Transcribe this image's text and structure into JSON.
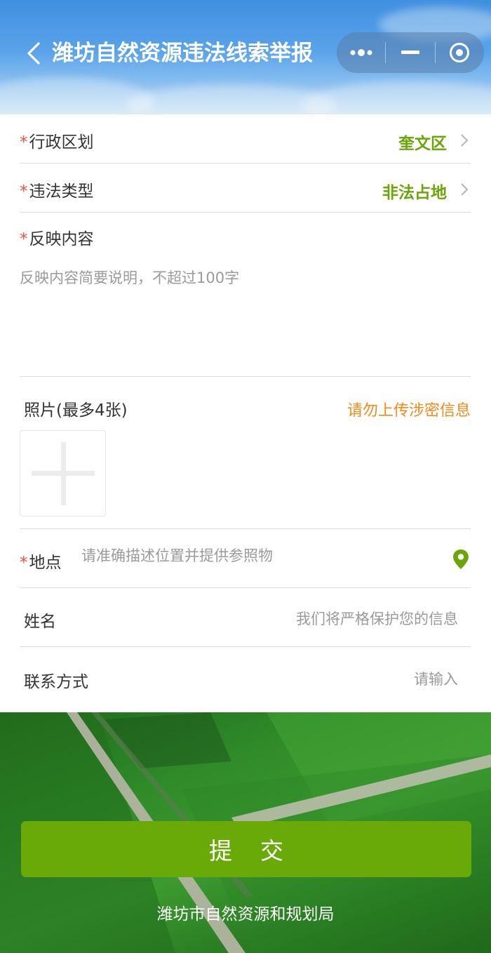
{
  "header": {
    "title": "潍坊自然资源违法线索举报",
    "icons": [
      "back-icon",
      "more-icon",
      "minimize-icon",
      "close-icon"
    ]
  },
  "form": {
    "required_mark": "*",
    "district": {
      "label": "行政区划",
      "value": "奎文区"
    },
    "violation_type": {
      "label": "违法类型",
      "value": "非法占地"
    },
    "content": {
      "label": "反映内容",
      "placeholder": "反映内容简要说明，不超过100字"
    },
    "photos": {
      "label": "照片(最多4张)",
      "warning": "请勿上传涉密信息"
    },
    "location": {
      "label": "地点",
      "placeholder": "请准确描述位置并提供参照物"
    },
    "name": {
      "label": "姓名",
      "placeholder": "我们将严格保护您的信息"
    },
    "contact": {
      "label": "联系方式",
      "placeholder": "请输入"
    }
  },
  "footer": {
    "submit_label": "提交",
    "organization": "潍坊市自然资源和规划局"
  },
  "colors": {
    "accent_green": "#6aa50a",
    "button_green": "#6aaa08",
    "required_red": "#e5533d",
    "warning_orange": "#f08a18"
  }
}
